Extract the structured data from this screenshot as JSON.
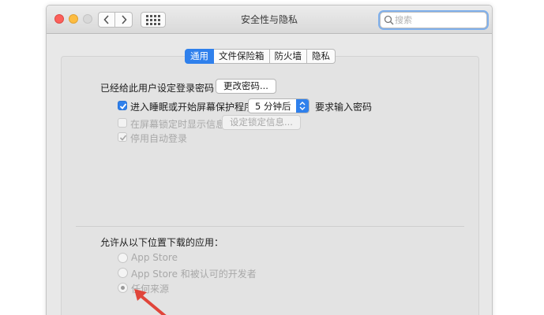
{
  "window": {
    "title": "安全性与隐私",
    "search": {
      "placeholder": "搜索",
      "value": ""
    }
  },
  "tabs": [
    {
      "label": "通用",
      "active": true
    },
    {
      "label": "文件保险箱",
      "active": false
    },
    {
      "label": "防火墙",
      "active": false
    },
    {
      "label": "隐私",
      "active": false
    }
  ],
  "general": {
    "password_set_text": "已经给此用户设定登录密码",
    "change_password_button": "更改密码...",
    "require_password": {
      "label": "进入睡眠或开始屏幕保护程序",
      "checked": true,
      "delay_value": "5 分钟后",
      "suffix": "要求输入密码"
    },
    "lock_message": {
      "label": "在屏幕锁定时显示信息",
      "checked": false,
      "button": "设定锁定信息..."
    },
    "disable_auto_login": {
      "label": "停用自动登录",
      "checked": true
    }
  },
  "downloads": {
    "heading": "允许从以下位置下载的应用：",
    "options": [
      {
        "label": "App Store",
        "selected": false
      },
      {
        "label": "App Store 和被认可的开发者",
        "selected": false
      },
      {
        "label": "任何来源",
        "selected": true
      }
    ]
  },
  "colors": {
    "accent": "#2f80ec",
    "annotation_arrow": "#e0453a"
  }
}
